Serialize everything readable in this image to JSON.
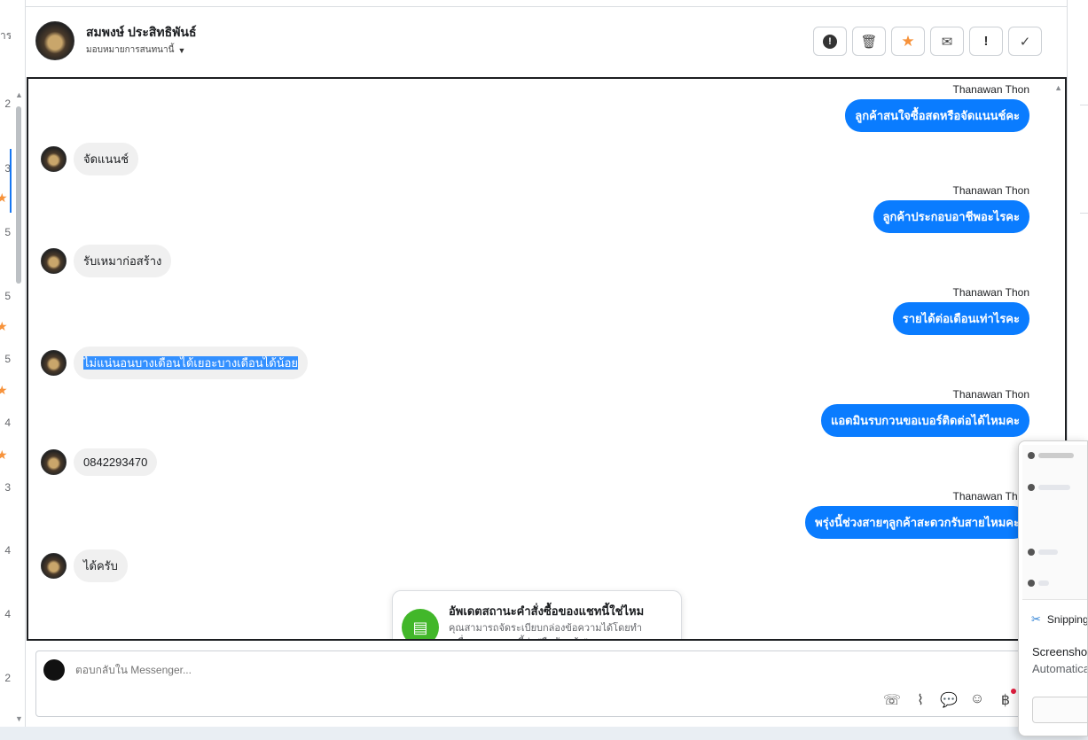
{
  "left_list": {
    "fragments": [
      "าร",
      "2",
      "3",
      "5",
      "5",
      "5",
      "4",
      "3",
      "4",
      "4",
      "2"
    ]
  },
  "header": {
    "contact_name": "สมพงษ์ ประสิทธิพันธ์",
    "assign_label": "มอบหมายการสนทนานี้",
    "actions": [
      {
        "icon": "alert-circle-icon",
        "glyph": "!"
      },
      {
        "icon": "trash-icon",
        "glyph": "🗑"
      },
      {
        "icon": "star-icon",
        "glyph": "★"
      },
      {
        "icon": "mark-unread-icon",
        "glyph": "✉"
      },
      {
        "icon": "exclamation-icon",
        "glyph": "!"
      },
      {
        "icon": "check-icon",
        "glyph": "✓"
      }
    ]
  },
  "messages": {
    "out": [
      {
        "sender": "Thanawan Thon",
        "text": "ลูกค้าสนใจซื้อสดหรือจัดแนนช์คะ"
      },
      {
        "sender": "Thanawan Thon",
        "text": "ลูกค้าประกอบอาชีพอะไรคะ"
      },
      {
        "sender": "Thanawan Thon",
        "text": "รายได้ต่อเดือนเท่าไรคะ"
      },
      {
        "sender": "Thanawan Thon",
        "text": "แอดมินรบกวนขอเบอร์ติดต่อได้ไหมคะ"
      },
      {
        "sender": "Thanawan Thon",
        "text": "พรุ่งนี้ช่วงสายๆลูกค้าสะดวกรับสายไหมคะ"
      }
    ],
    "in": [
      {
        "text": "จัดแนนช์"
      },
      {
        "text": "รับเหมาก่อสร้าง"
      },
      {
        "text": "ไม่แน่นอนบางเดือนได้เยอะบางเดือนได้น้อย"
      },
      {
        "text": "0842293470"
      },
      {
        "text": "ได้ครับ"
      }
    ]
  },
  "toast": {
    "title": "อัพเดตสถานะคำสั่งซื้อของแชทนี้ใช่ไหม",
    "body": "คุณสามารถจัดระเบียบกล่องข้อความได้โดยทำเครื่องหมายแชทนี้ว่า \"ยืนยันแล้ว\""
  },
  "composer": {
    "placeholder": "ตอบกลับใน Messenger...",
    "tools": [
      {
        "icon": "add-call-icon",
        "glyph": "☏"
      },
      {
        "icon": "attach-icon",
        "glyph": "⌇"
      },
      {
        "icon": "saved-reply-icon",
        "glyph": "💬"
      },
      {
        "icon": "emoji-icon",
        "glyph": "☺"
      },
      {
        "icon": "baht-icon",
        "glyph": "฿"
      }
    ]
  },
  "snipping_tool": {
    "app_name": "Snipping Tool",
    "title": "Screenshot copied to clipboard",
    "subtitle": "Automatically saved to screenshots folder"
  }
}
